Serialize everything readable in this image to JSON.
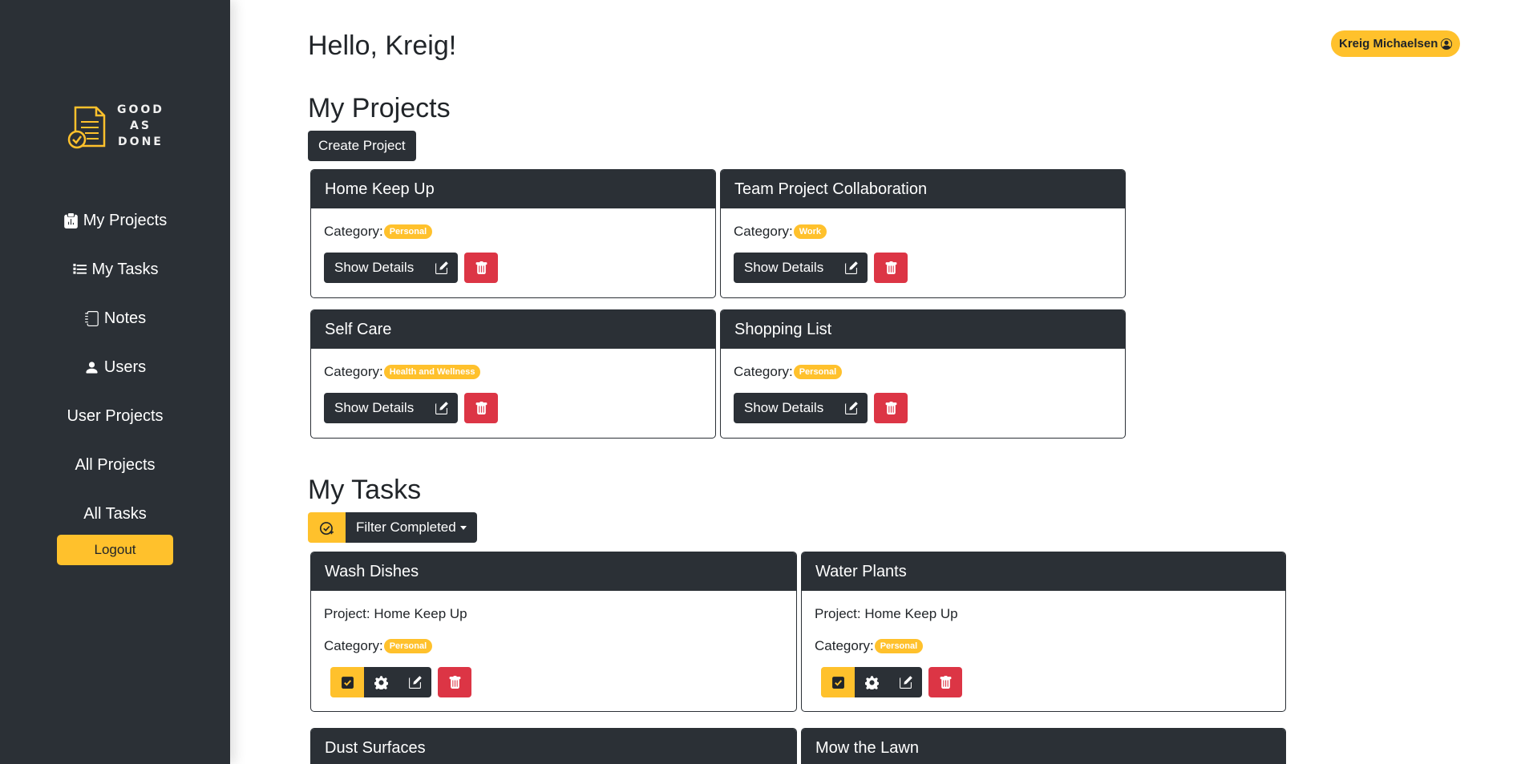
{
  "sidebar": {
    "logo": {
      "line1": "GOOD",
      "line2": "AS",
      "line3": "DONE"
    },
    "items": [
      {
        "label": "My Projects",
        "icon": "clipboard-data-icon"
      },
      {
        "label": "My Tasks",
        "icon": "list-check-icon"
      },
      {
        "label": "Notes",
        "icon": "notebook-icon"
      },
      {
        "label": "Users",
        "icon": "person-icon"
      },
      {
        "label": "User Projects",
        "icon": ""
      },
      {
        "label": "All Projects",
        "icon": ""
      },
      {
        "label": "All Tasks",
        "icon": ""
      }
    ],
    "logout_label": "Logout"
  },
  "header": {
    "greeting": "Hello, Kreig!",
    "user_name": "Kreig Michaelsen"
  },
  "projects": {
    "title": "My Projects",
    "create_label": "Create Project",
    "category_prefix": "Category:",
    "show_label": "Show Details",
    "items": [
      {
        "name": "Home Keep Up",
        "category": "Personal"
      },
      {
        "name": "Team Project Collaboration",
        "category": "Work"
      },
      {
        "name": "Self Care",
        "category": "Health and Wellness"
      },
      {
        "name": "Shopping List",
        "category": "Personal"
      }
    ]
  },
  "tasks": {
    "title": "My Tasks",
    "filter_label": "Filter Completed",
    "project_prefix": "Project:",
    "category_prefix": "Category:",
    "items": [
      {
        "name": "Wash Dishes",
        "project": "Home Keep Up",
        "category": "Personal"
      },
      {
        "name": "Water Plants",
        "project": "Home Keep Up",
        "category": "Personal"
      },
      {
        "name": "Dust Surfaces"
      },
      {
        "name": "Mow the Lawn"
      }
    ]
  },
  "colors": {
    "sidebar_bg": "#2b3036",
    "accent": "#ffc12c",
    "danger": "#dc3545",
    "card_header": "#2b3036"
  }
}
